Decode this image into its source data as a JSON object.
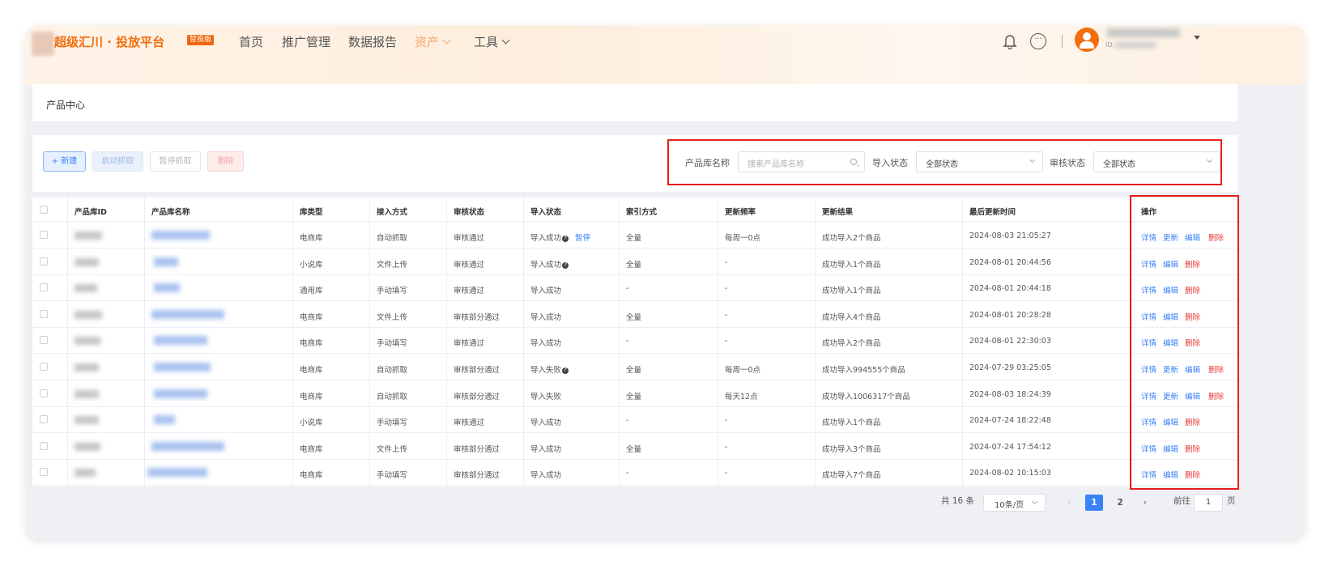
{
  "header": {
    "brand": "超级汇川 · 投放平台",
    "badge": "智投版",
    "nav": [
      "首页",
      "推广管理",
      "数据报告",
      "资产",
      "工具"
    ],
    "user_id_label": "ID:"
  },
  "breadcrumb": {
    "title": "产品中心"
  },
  "toolbar": {
    "new_label": "+ 新建",
    "start_label": "启动抓取",
    "pause_label": "暂停抓取",
    "delete_label": "删除"
  },
  "filters": {
    "name_label": "产品库名称",
    "name_placeholder": "搜索产品库名称",
    "import_label": "导入状态",
    "import_value": "全部状态",
    "audit_label": "审核状态",
    "audit_value": "全部状态"
  },
  "table": {
    "columns": [
      "产品库ID",
      "产品库名称",
      "库类型",
      "接入方式",
      "审核状态",
      "导入状态",
      "索引方式",
      "更新频率",
      "更新结果",
      "最后更新时间",
      "操作"
    ],
    "rows": [
      {
        "type": "电商库",
        "access": "自动抓取",
        "audit": "审核通过",
        "import": "导入成功",
        "import_help": true,
        "pause": "暂停",
        "index": "全量",
        "freq": "每周一0点",
        "result": "成功导入2个商品",
        "time": "2024-08-03 21:05:27",
        "actions": [
          "详情",
          "更新",
          "编辑",
          "删除"
        ]
      },
      {
        "type": "小说库",
        "access": "文件上传",
        "audit": "审核通过",
        "import": "导入成功",
        "import_help": true,
        "pause": "",
        "index": "全量",
        "freq": "-",
        "result": "成功导入1个商品",
        "time": "2024-08-01 20:44:56",
        "actions": [
          "详情",
          "编辑",
          "删除"
        ]
      },
      {
        "type": "通用库",
        "access": "手动填写",
        "audit": "审核通过",
        "import": "导入成功",
        "import_help": false,
        "pause": "",
        "index": "-",
        "freq": "-",
        "result": "成功导入1个商品",
        "time": "2024-08-01 20:44:18",
        "actions": [
          "详情",
          "编辑",
          "删除"
        ]
      },
      {
        "type": "电商库",
        "access": "文件上传",
        "audit": "审核部分通过",
        "import": "导入成功",
        "import_help": false,
        "pause": "",
        "index": "全量",
        "freq": "-",
        "result": "成功导入4个商品",
        "time": "2024-08-01 20:28:28",
        "actions": [
          "详情",
          "编辑",
          "删除"
        ]
      },
      {
        "type": "电商库",
        "access": "手动填写",
        "audit": "审核通过",
        "import": "导入成功",
        "import_help": false,
        "pause": "",
        "index": "-",
        "freq": "-",
        "result": "成功导入2个商品",
        "time": "2024-08-01 22:30:03",
        "actions": [
          "详情",
          "编辑",
          "删除"
        ]
      },
      {
        "type": "电商库",
        "access": "自动抓取",
        "audit": "审核部分通过",
        "import": "导入失败",
        "import_help": true,
        "pause": "",
        "index": "全量",
        "freq": "每周一0点",
        "result": "成功导入994555个商品",
        "time": "2024-07-29 03:25:05",
        "actions": [
          "详情",
          "更新",
          "编辑",
          "删除"
        ]
      },
      {
        "type": "电商库",
        "access": "自动抓取",
        "audit": "审核部分通过",
        "import": "导入失败",
        "import_help": false,
        "pause": "",
        "index": "全量",
        "freq": "每天12点",
        "result": "成功导入1006317个商品",
        "time": "2024-08-03 18:24:39",
        "actions": [
          "详情",
          "更新",
          "编辑",
          "删除"
        ]
      },
      {
        "type": "小说库",
        "access": "手动填写",
        "audit": "审核通过",
        "import": "导入成功",
        "import_help": false,
        "pause": "",
        "index": "-",
        "freq": "-",
        "result": "成功导入1个商品",
        "time": "2024-07-24 18:22:48",
        "actions": [
          "详情",
          "编辑",
          "删除"
        ]
      },
      {
        "type": "电商库",
        "access": "文件上传",
        "audit": "审核部分通过",
        "import": "导入成功",
        "import_help": false,
        "pause": "",
        "index": "全量",
        "freq": "-",
        "result": "成功导入3个商品",
        "time": "2024-07-24 17:54:12",
        "actions": [
          "详情",
          "编辑",
          "删除"
        ]
      },
      {
        "type": "电商库",
        "access": "手动填写",
        "audit": "审核部分通过",
        "import": "导入成功",
        "import_help": false,
        "pause": "",
        "index": "-",
        "freq": "-",
        "result": "成功导入7个商品",
        "time": "2024-08-02 10:15:03",
        "actions": [
          "详情",
          "编辑",
          "删除"
        ]
      }
    ]
  },
  "pagination": {
    "total": "共 16 条",
    "page_size": "10条/页",
    "pages": [
      "1",
      "2"
    ],
    "current": "1",
    "goto_label": "前往",
    "goto_value": "1",
    "page_unit": "页"
  },
  "colors": {
    "accent": "#f26d0c",
    "link": "#3b82f6",
    "danger": "#e83a3a",
    "highlight": "#e81d1d"
  },
  "icons": [
    "bell-icon",
    "more-icon",
    "avatar-icon",
    "search-icon",
    "chevron-down-icon",
    "help-icon",
    "prev-icon",
    "next-icon"
  ]
}
